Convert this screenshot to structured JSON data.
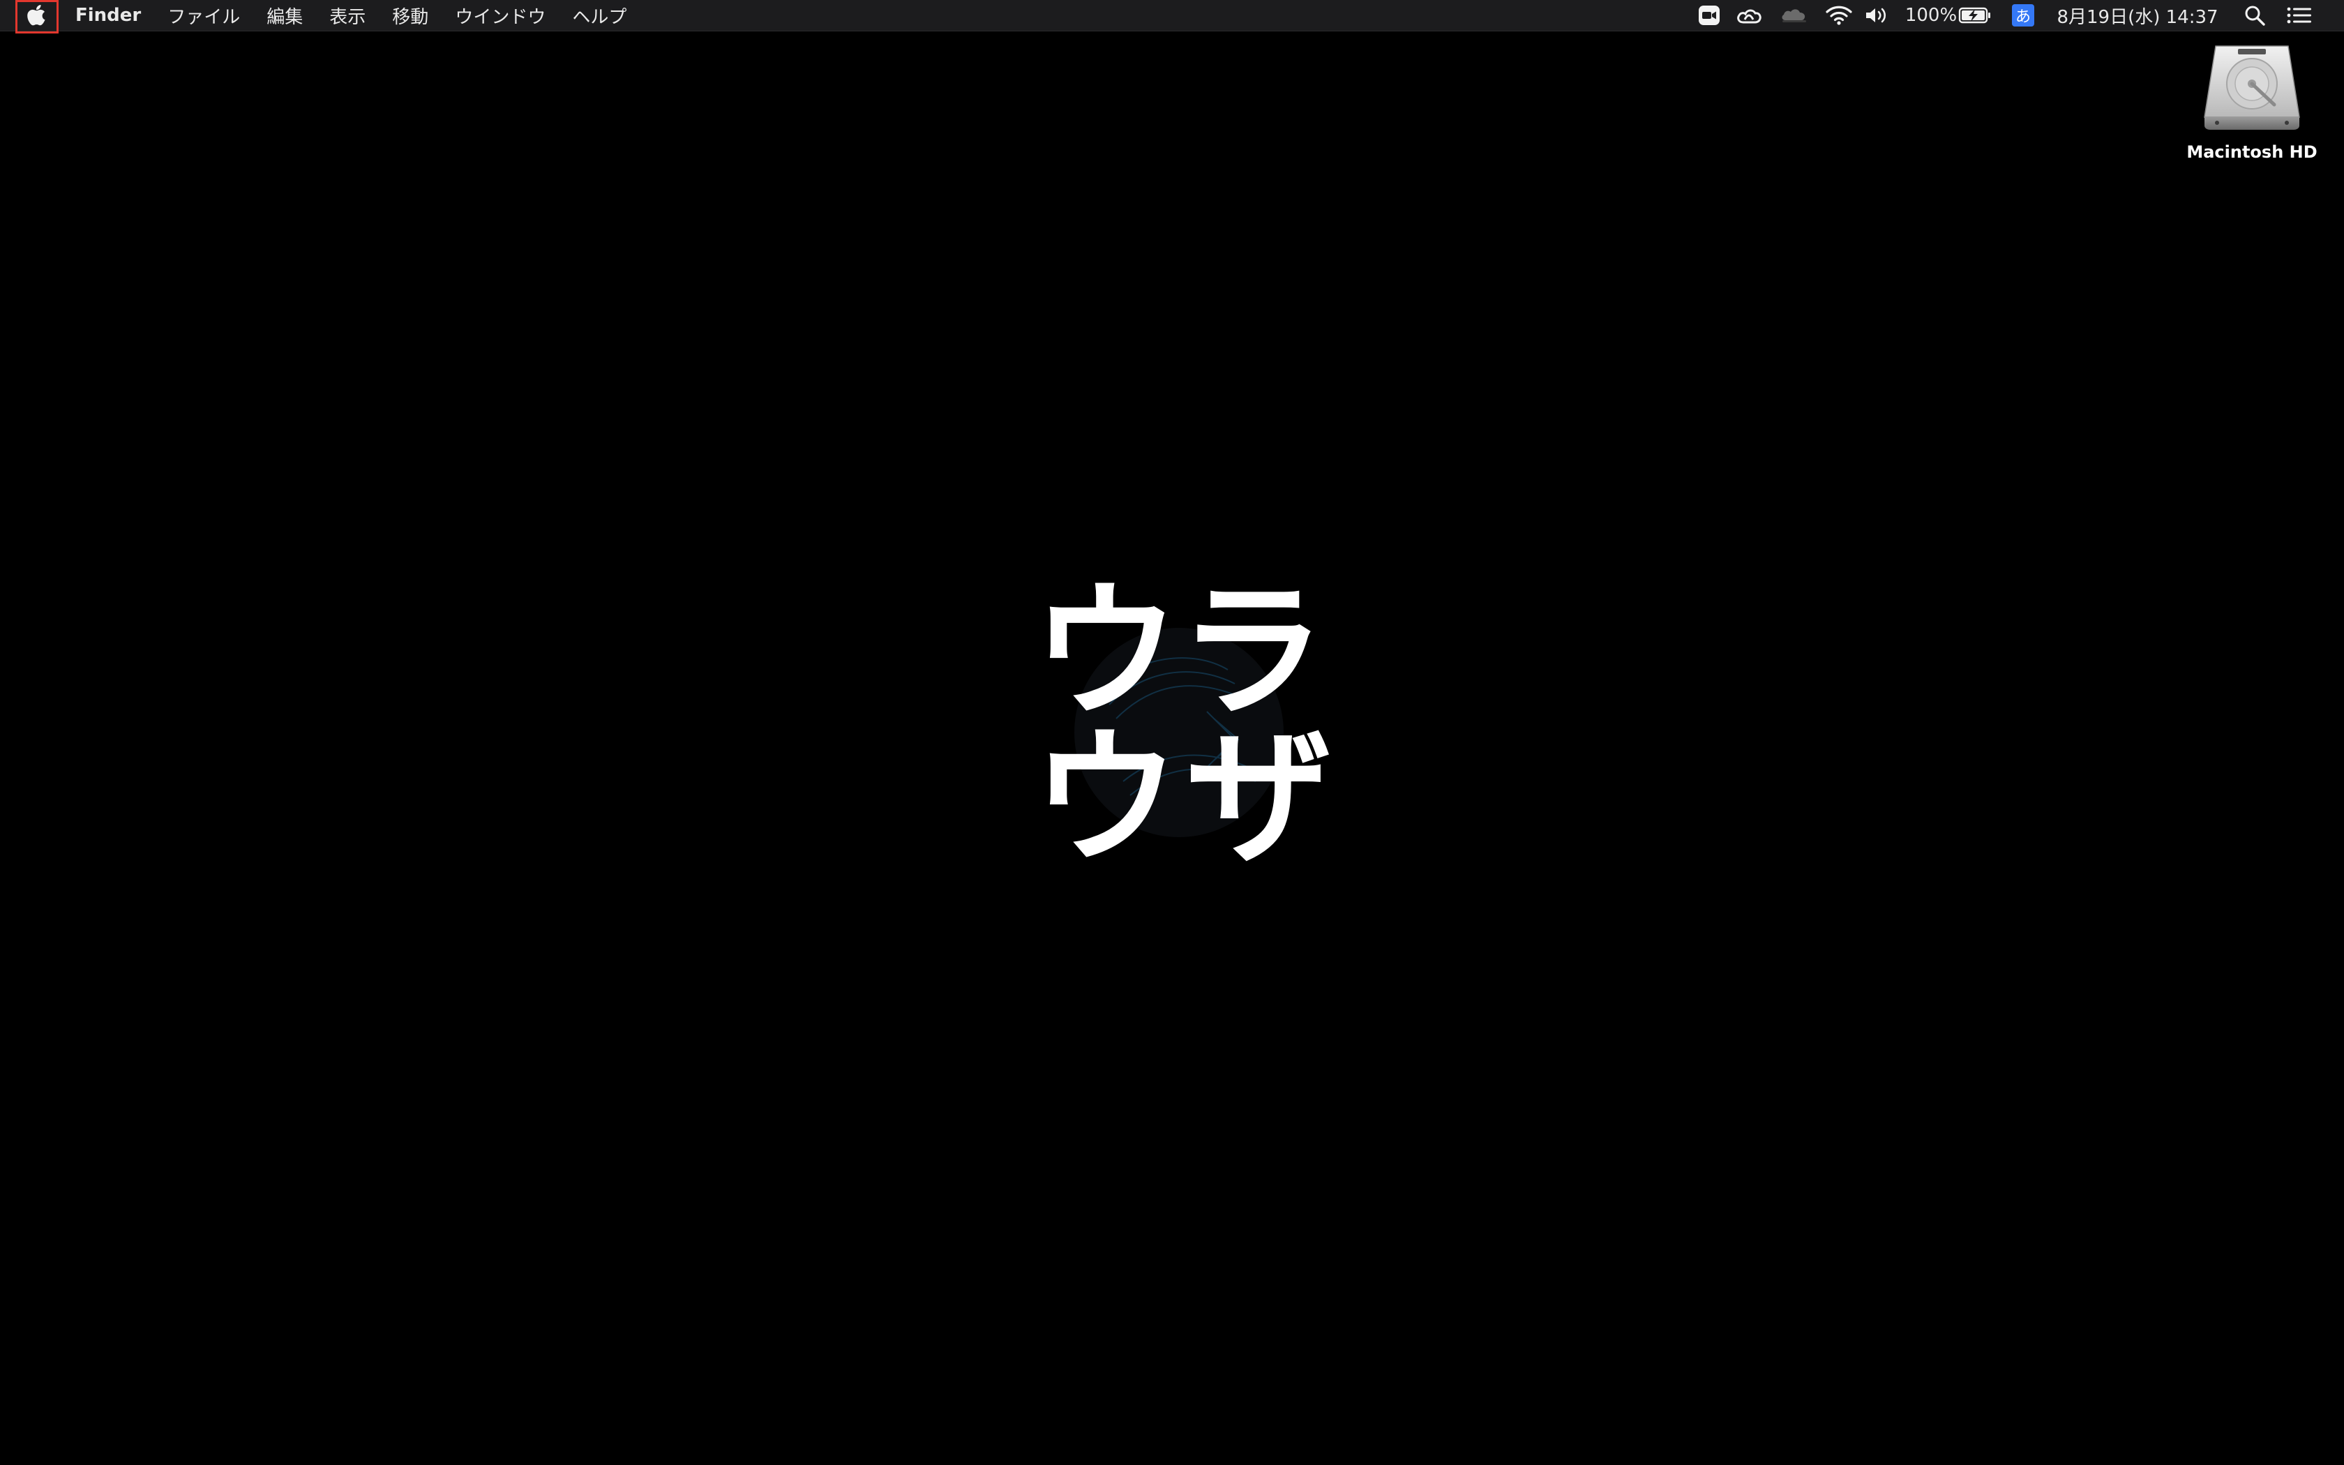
{
  "menubar": {
    "apple_icon": "apple-logo-icon",
    "app_name": "Finder",
    "menus": [
      "ファイル",
      "編集",
      "表示",
      "移動",
      "ウインドウ",
      "ヘルプ"
    ],
    "status": {
      "zoom_icon": "zoom-video-icon",
      "creative_cloud_icon": "creative-cloud-icon",
      "cloud_icon": "cloud-app-icon",
      "wifi_icon": "wifi-icon",
      "volume_icon": "volume-icon",
      "battery_percent": "100%",
      "battery_icon": "battery-charging-icon",
      "input_method": "あ",
      "datetime": "8月19日(水)  14:37",
      "spotlight_icon": "search-icon",
      "notification_icon": "notification-center-icon"
    }
  },
  "desktop": {
    "drive_label": "Macintosh HD",
    "wallpaper_glyphs": [
      "ウ",
      "ラ",
      "ウ",
      "ザ"
    ]
  }
}
